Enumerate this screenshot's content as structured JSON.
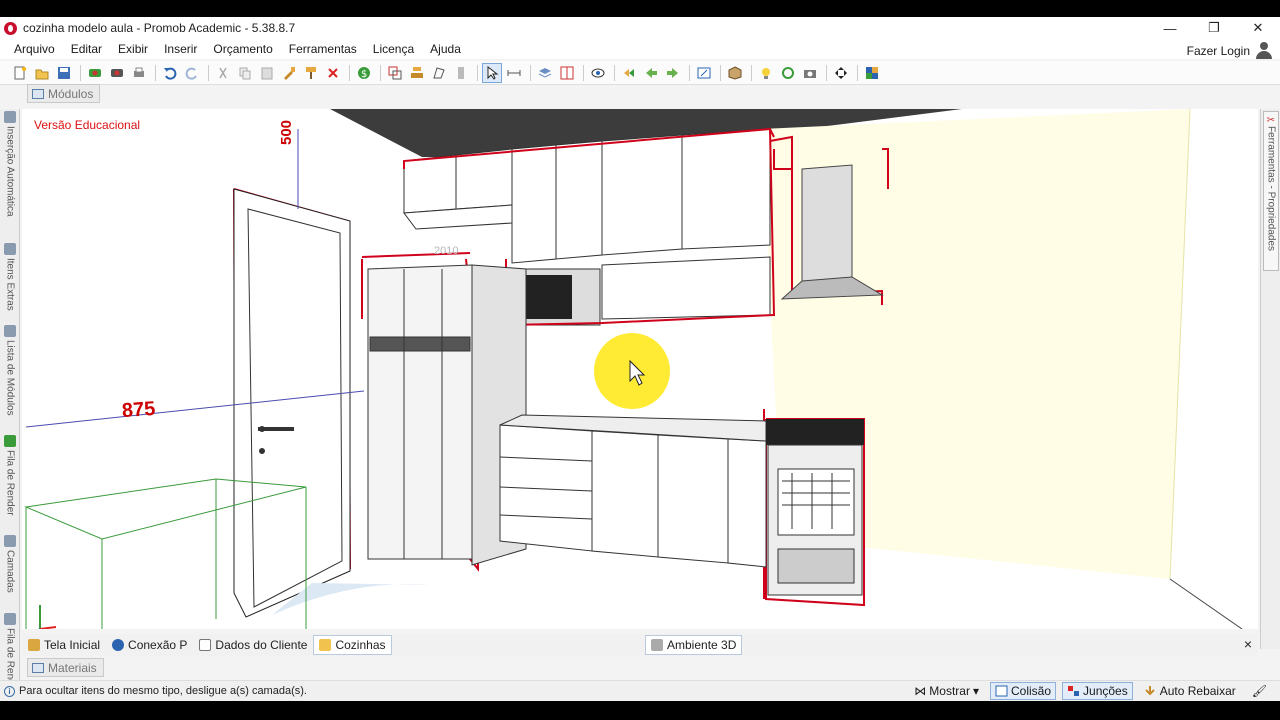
{
  "window": {
    "title": "cozinha modelo aula - Promob Academic - 5.38.8.7",
    "minimize": "—",
    "restore": "❐",
    "close": "✕"
  },
  "menu": [
    "Arquivo",
    "Editar",
    "Exibir",
    "Inserir",
    "Orçamento",
    "Ferramentas",
    "Licença",
    "Ajuda"
  ],
  "login": {
    "label": "Fazer Login"
  },
  "toolbar_icons": [
    "new-file",
    "open-folder",
    "save",
    "render",
    "render-alt",
    "print",
    "undo",
    "redo",
    "cut",
    "copy",
    "paste",
    "pick",
    "paint",
    "delete",
    "budget",
    "group",
    "align",
    "shape",
    "wall",
    "select-arrow",
    "measure",
    "layers",
    "split",
    "view",
    "nav-left",
    "nav-back",
    "nav-forward",
    "camera-view",
    "box-3d",
    "light",
    "rotate",
    "camera",
    "move",
    "grid-color"
  ],
  "panels": {
    "modulos": "Módulos",
    "materiais": "Materiais",
    "left_tabs": [
      "Inserção Automática",
      "Itens Extras",
      "Lista de Módulos",
      "Fila de Render",
      "Camadas",
      "Fila de Render"
    ],
    "right_tab": "Ferramentas - Propriedades"
  },
  "viewport": {
    "watermark": "Versão Educacional",
    "dimensions": {
      "height": "500",
      "width": "875",
      "tag": "2010"
    }
  },
  "bottom_tabs": [
    "Tela Inicial",
    "Conexão P",
    "Dados do Cliente",
    "Cozinhas"
  ],
  "ambiente": "Ambiente 3D",
  "close_panel": "×",
  "status": {
    "message": "Para ocultar itens do mesmo tipo, desligue a(s) camada(s).",
    "mostrar": "Mostrar",
    "colisao": "Colisão",
    "juncoes": "Junções",
    "auto_rebaixar": "Auto Rebaixar"
  },
  "colors": {
    "selection": "#d0021b",
    "wall": "#fffde6",
    "highlight": "#ffe600",
    "ceiling": "#3c3c3c"
  }
}
